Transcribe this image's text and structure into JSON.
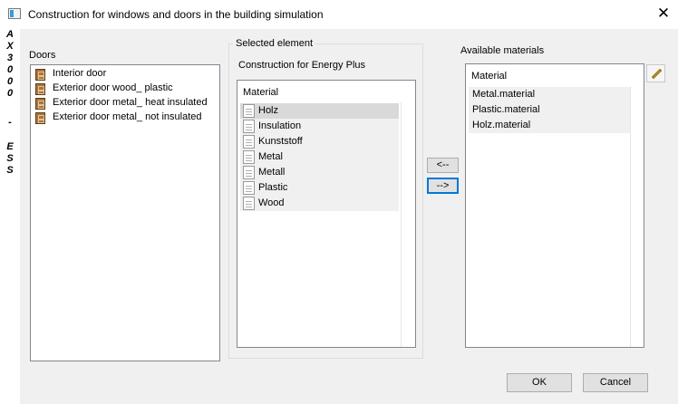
{
  "window": {
    "title": "Construction for windows and doors in the building simulation",
    "close_glyph": "✕"
  },
  "side_strip": {
    "chars": [
      "A",
      "X",
      "3",
      "0",
      "0",
      "0",
      "-",
      "E",
      "S",
      "S"
    ]
  },
  "doors": {
    "label": "Doors",
    "items": [
      {
        "label": "Interior door",
        "icon": "door-icon"
      },
      {
        "label": "Exterior door wood_ plastic",
        "icon": "door-icon"
      },
      {
        "label": "Exterior door metal_ heat insulated",
        "icon": "door-icon"
      },
      {
        "label": "Exterior door metal_ not insulated",
        "icon": "door-icon"
      }
    ]
  },
  "selected_element": {
    "group_title": "Selected element",
    "construction_label": "Construction for Energy Plus",
    "column_header": "Material",
    "materials": [
      {
        "label": "Holz",
        "selected": true,
        "icon": "document-icon"
      },
      {
        "label": "Insulation",
        "selected": false,
        "icon": "document-icon"
      },
      {
        "label": "Kunststoff",
        "selected": false,
        "icon": "document-icon"
      },
      {
        "label": "Metal",
        "selected": false,
        "icon": "document-icon"
      },
      {
        "label": "Metall",
        "selected": false,
        "icon": "document-icon"
      },
      {
        "label": "Plastic",
        "selected": false,
        "icon": "document-icon"
      },
      {
        "label": "Wood",
        "selected": false,
        "icon": "document-icon"
      }
    ]
  },
  "transfer": {
    "add_label": "<--",
    "remove_label": "-->"
  },
  "available": {
    "label": "Available materials",
    "column_header": "Material",
    "items": [
      {
        "label": "Metal.material"
      },
      {
        "label": "Plastic.material"
      },
      {
        "label": "Holz.material"
      }
    ],
    "edit_icon": "pencil-icon"
  },
  "footer": {
    "ok_label": "OK",
    "cancel_label": "Cancel"
  },
  "colors": {
    "focus_blue": "#0078d7",
    "dialog_bg": "#f0f0f0",
    "door_brown": "#a9743f"
  }
}
